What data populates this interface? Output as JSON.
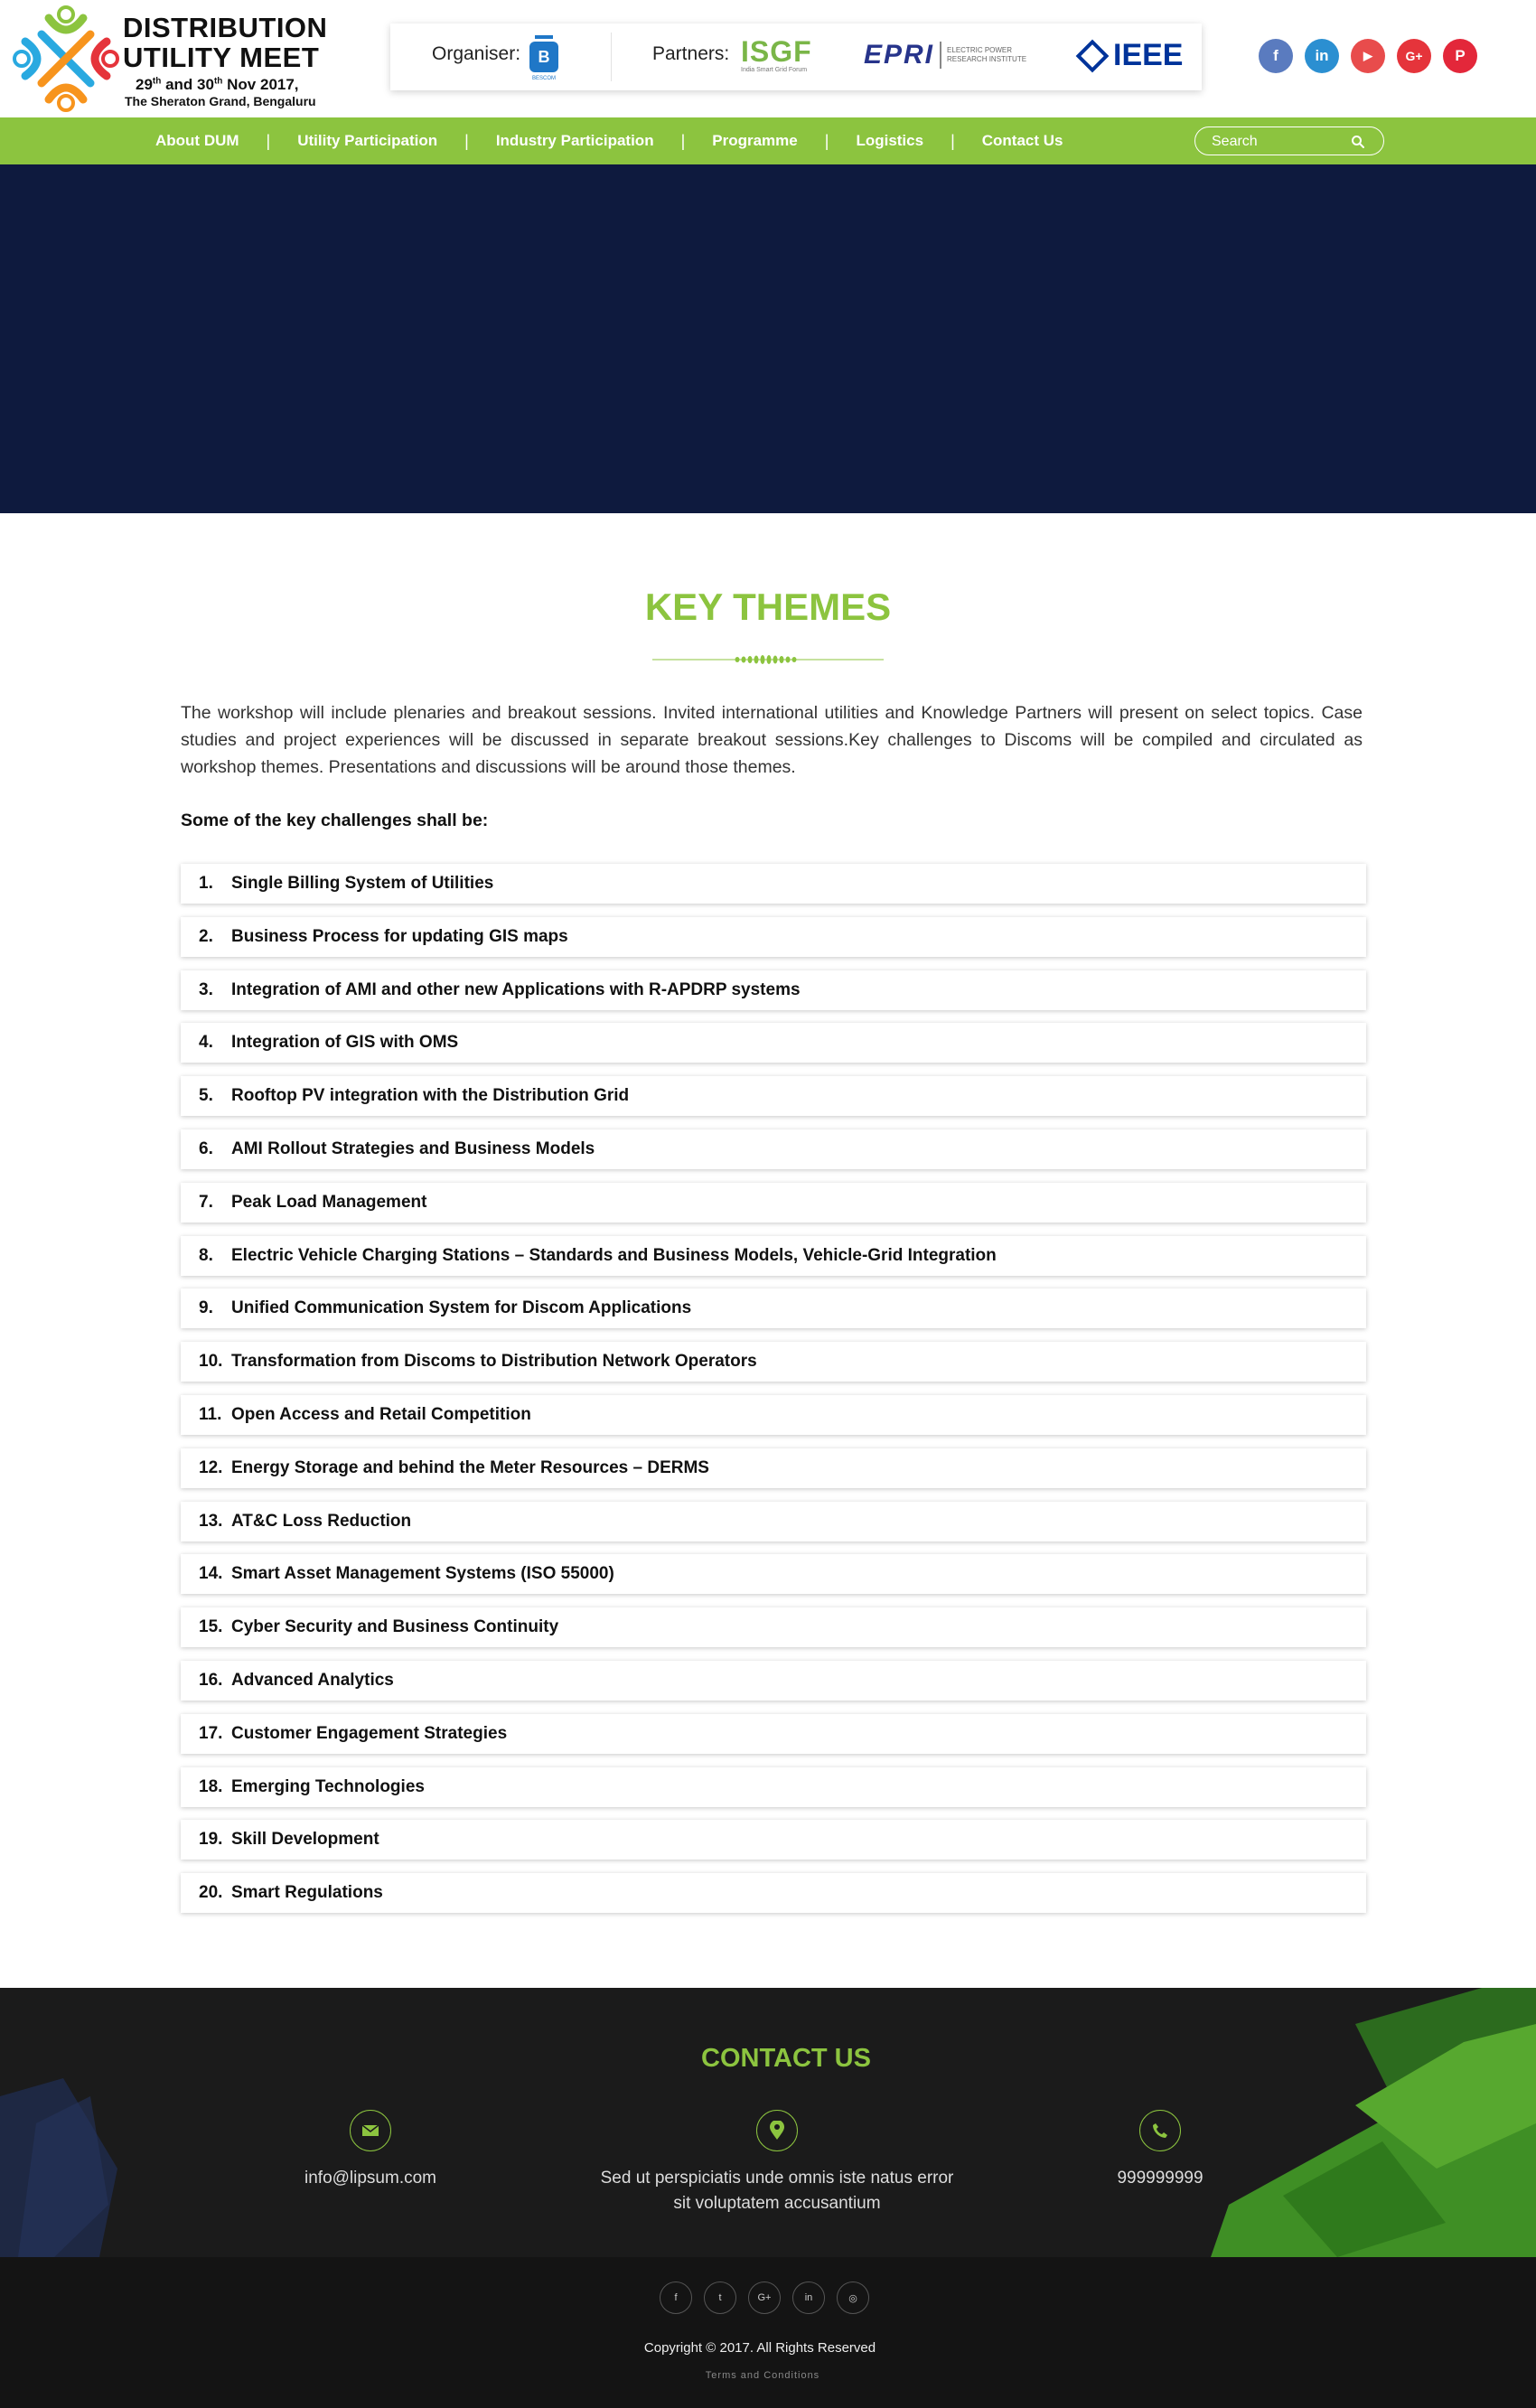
{
  "logo": {
    "line1": "DISTRIBUTION",
    "line2": "UTILITY MEET",
    "dates_a": "29",
    "dates_sup_a": "th",
    "dates_b": " and 30",
    "dates_sup_b": "th",
    "dates_c": " Nov 2017,",
    "venue": "The Sheraton Grand, Bengaluru"
  },
  "partners": {
    "organiser_label": "Organiser:",
    "partners_label": "Partners:",
    "bescom_text": "BESCOM",
    "isgf_text": "ISGF",
    "isgf_sub": "India Smart Grid Forum",
    "epri_text": "EPRI",
    "epri_sub1": "Electric Power",
    "epri_sub2": "Research Institute",
    "ieee_text": "IEEE"
  },
  "socials": [
    {
      "label": "f",
      "icon": "facebook-icon",
      "color": "#5a7bbf"
    },
    {
      "label": "in",
      "icon": "linkedin-icon",
      "color": "#2b8fd1"
    },
    {
      "label": "▶",
      "icon": "youtube-icon",
      "color": "#e84c4c"
    },
    {
      "label": "G+",
      "icon": "google-plus-icon",
      "color": "#e5343b"
    },
    {
      "label": "P",
      "icon": "pinterest-icon",
      "color": "#e3273a"
    }
  ],
  "nav": {
    "items": [
      "About DUM",
      "Utility Participation",
      "Industry Participation",
      "Programme",
      "Logistics",
      "Contact Us"
    ],
    "separator": "|",
    "search_placeholder": "Search"
  },
  "key_themes": {
    "title": "KEY THEMES",
    "intro": "The workshop will include plenaries and breakout sessions. Invited international utilities and Knowledge Partners will present on select topics. Case studies and project experiences will be discussed in separate breakout sessions.Key challenges to Discoms will be compiled and circulated as workshop themes. Presentations and discussions will be around those themes.",
    "subheading": "Some of the key challenges shall be:",
    "items": [
      {
        "num": "1.",
        "text": "Single Billing System of Utilities"
      },
      {
        "num": "2.",
        "text": "Business Process for updating GIS maps"
      },
      {
        "num": "3.",
        "text": "Integration of AMI and other new Applications with R-APDRP systems"
      },
      {
        "num": "4.",
        "text": "Integration of GIS with OMS"
      },
      {
        "num": "5.",
        "text": "Rooftop PV integration with the Distribution Grid"
      },
      {
        "num": "6.",
        "text": "AMI Rollout Strategies and Business Models"
      },
      {
        "num": "7.",
        "text": "Peak Load Management"
      },
      {
        "num": "8.",
        "text": "Electric Vehicle Charging Stations – Standards and Business Models, Vehicle-Grid Integration"
      },
      {
        "num": "9.",
        "text": "Unified Communication System for Discom Applications"
      },
      {
        "num": "10.",
        "text": "Transformation from Discoms to Distribution Network Operators"
      },
      {
        "num": "11.",
        "text": "Open Access and Retail Competition"
      },
      {
        "num": "12.",
        "text": "Energy Storage and behind the Meter Resources – DERMS"
      },
      {
        "num": "13.",
        "text": "AT&C Loss Reduction"
      },
      {
        "num": "14.",
        "text": "Smart Asset Management Systems (ISO 55000)"
      },
      {
        "num": "15.",
        "text": "Cyber Security and Business Continuity"
      },
      {
        "num": "16.",
        "text": "Advanced Analytics"
      },
      {
        "num": "17.",
        "text": "Customer Engagement Strategies"
      },
      {
        "num": "18.",
        "text": "Emerging Technologies"
      },
      {
        "num": "19.",
        "text": "Skill Development"
      },
      {
        "num": "20.",
        "text": "Smart Regulations"
      }
    ]
  },
  "contact": {
    "title": "CONTACT US",
    "email": "info@lipsum.com",
    "address_line1": "Sed ut perspiciatis unde omnis iste natus error",
    "address_line2": "sit voluptatem accusantium",
    "phone": "999999999"
  },
  "footer": {
    "socials": [
      {
        "label": "f",
        "icon": "facebook-icon"
      },
      {
        "label": "t",
        "icon": "twitter-icon"
      },
      {
        "label": "G+",
        "icon": "google-plus-icon"
      },
      {
        "label": "in",
        "icon": "linkedin-icon"
      },
      {
        "label": "◎",
        "icon": "instagram-icon"
      }
    ],
    "copyright": "Copyright © 2017. All Rights Reserved",
    "terms": "Terms and Conditions"
  },
  "colors": {
    "accent_green": "#8cc43f",
    "hero_navy": "#0e1a3e",
    "footer_dark": "#1b1b1b"
  }
}
